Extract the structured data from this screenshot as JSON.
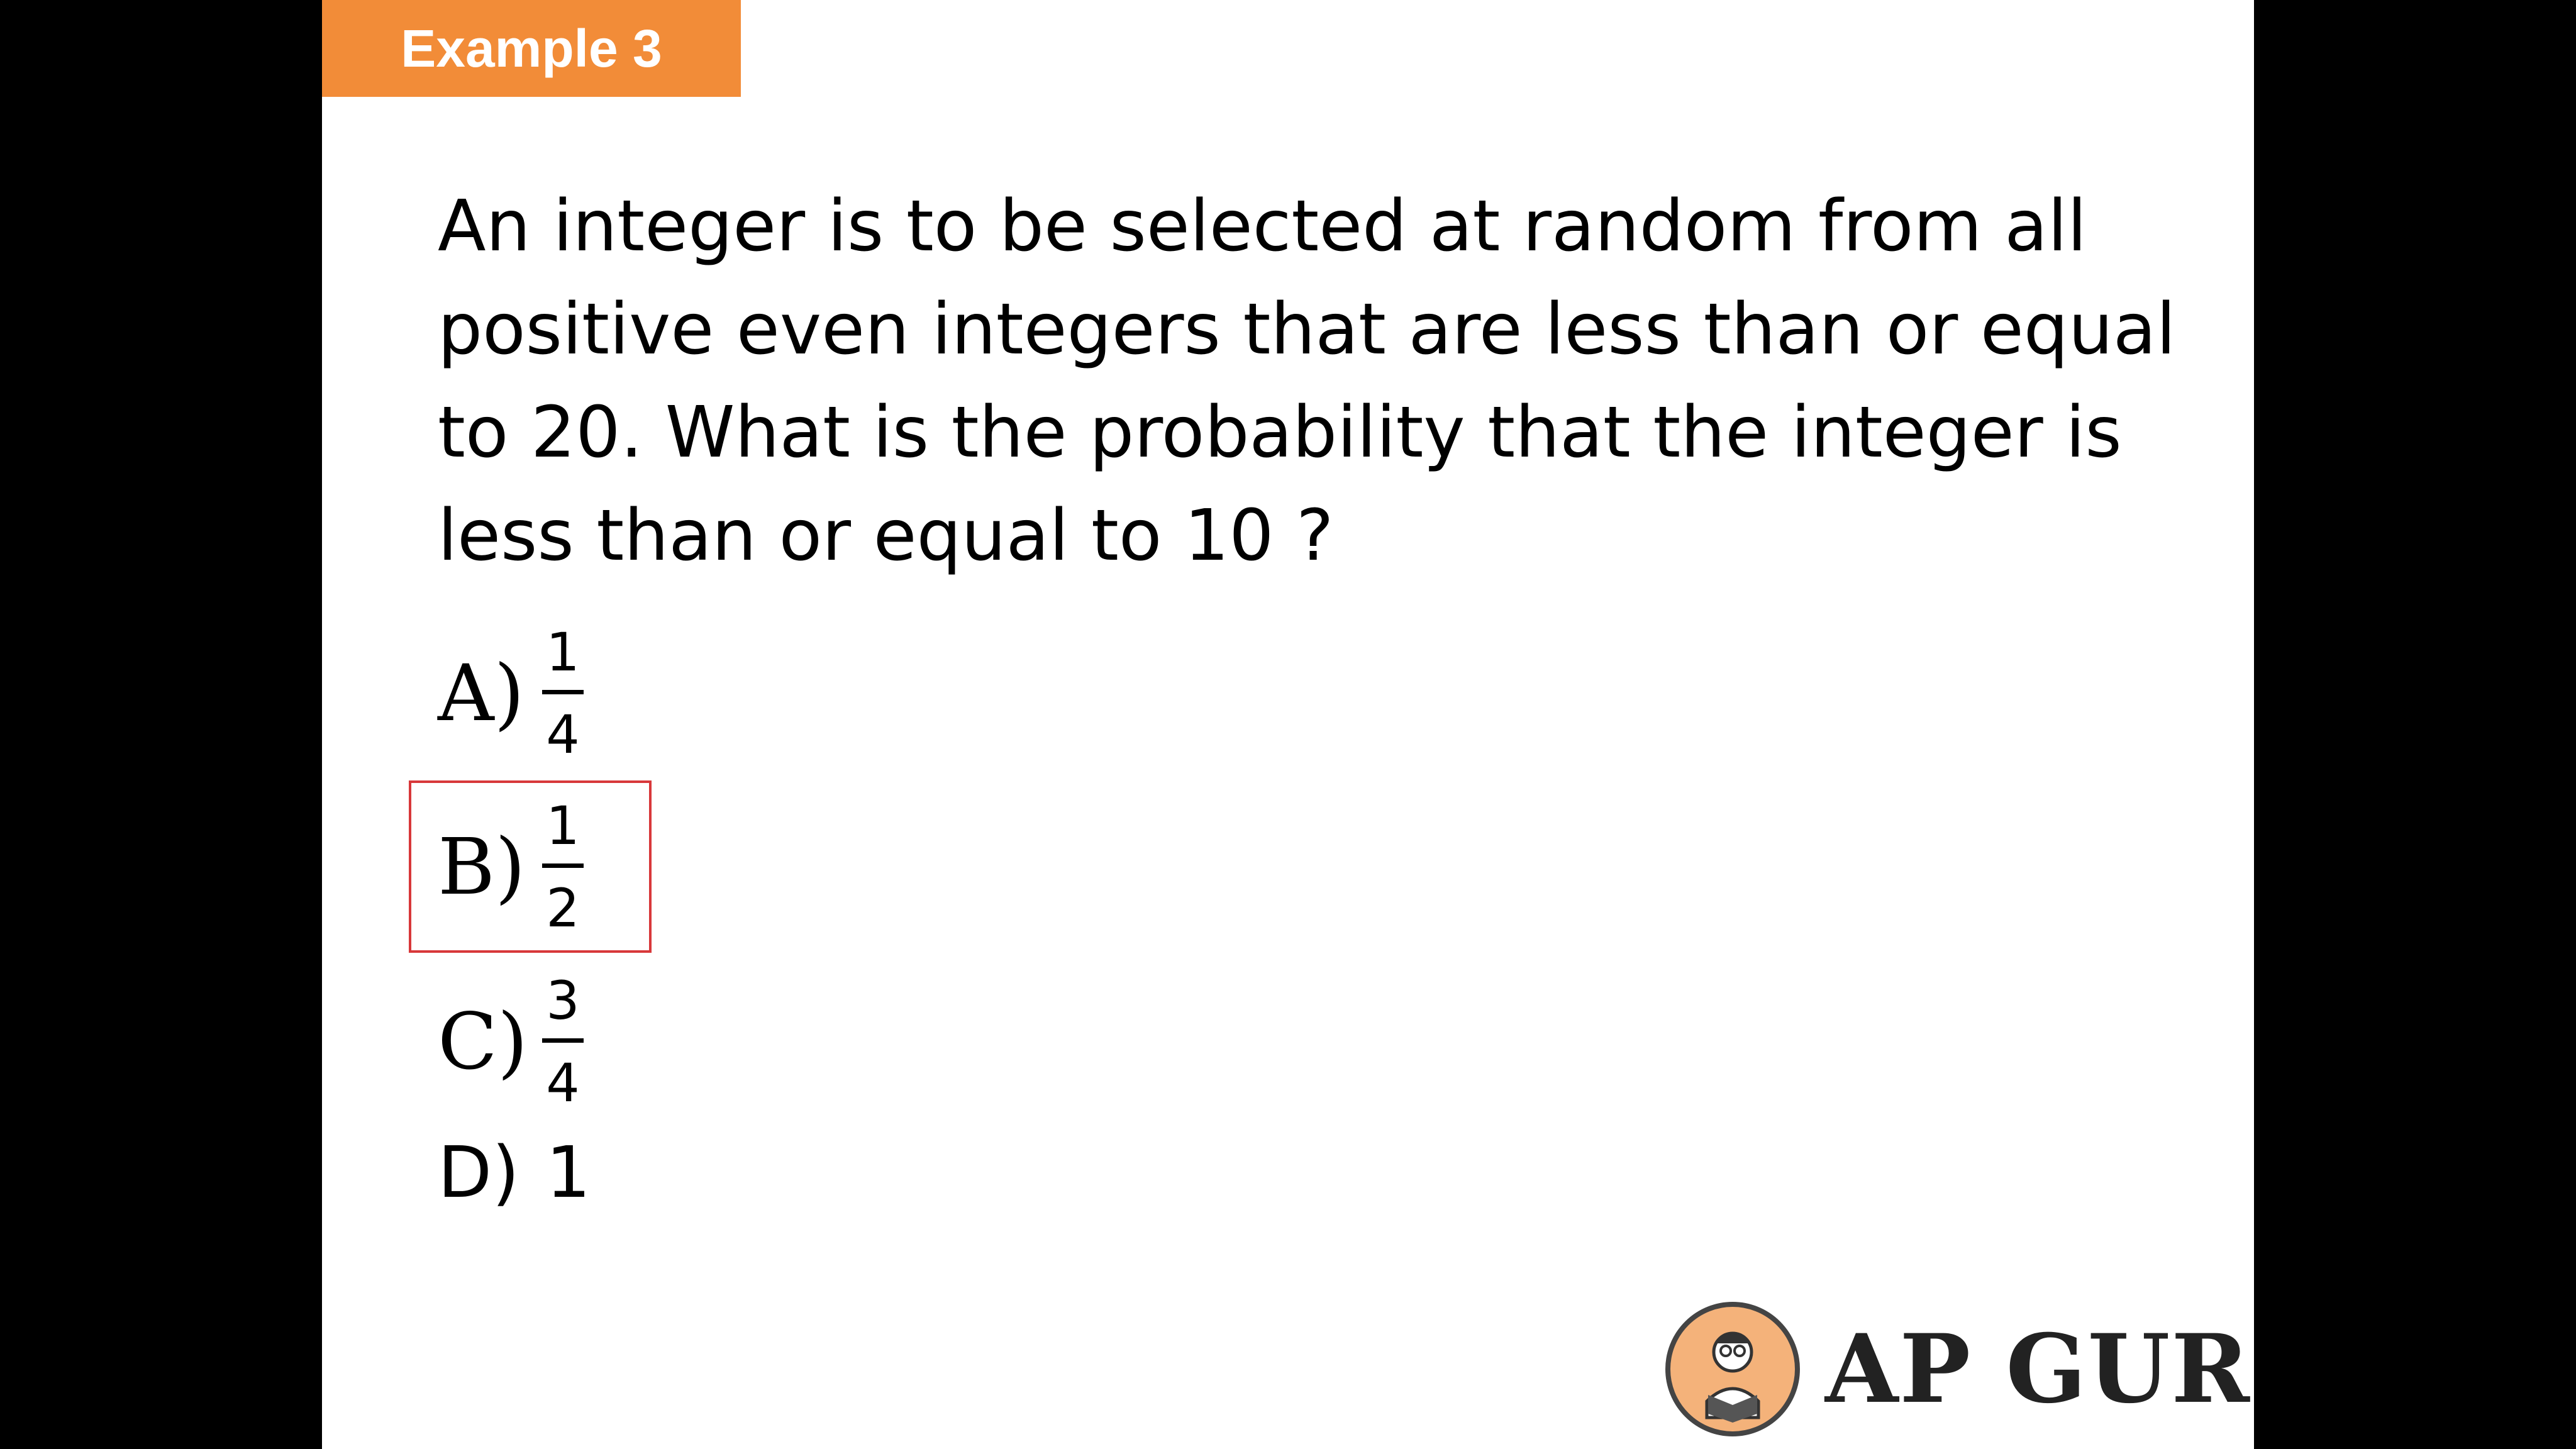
{
  "header": {
    "tag_label": "Example 3",
    "tag_color": "#f28c38"
  },
  "question": {
    "line1": "An integer is to be selected at random from all",
    "line2": "positive even integers that are less than or equal",
    "line3": "to 20. What is the probability that the integer is",
    "line4": "less than or equal to 10 ?"
  },
  "options": {
    "a": {
      "letter": "A)",
      "numerator": "1",
      "denominator": "4"
    },
    "b": {
      "letter": "B)",
      "numerator": "1",
      "denominator": "2"
    },
    "c": {
      "letter": "C)",
      "numerator": "3",
      "denominator": "4"
    },
    "d": {
      "letter": "D)",
      "value": "1"
    }
  },
  "highlight_color": "#d8383a",
  "logo": {
    "text": "AP GURU",
    "icon": "reader-mascot-icon"
  }
}
